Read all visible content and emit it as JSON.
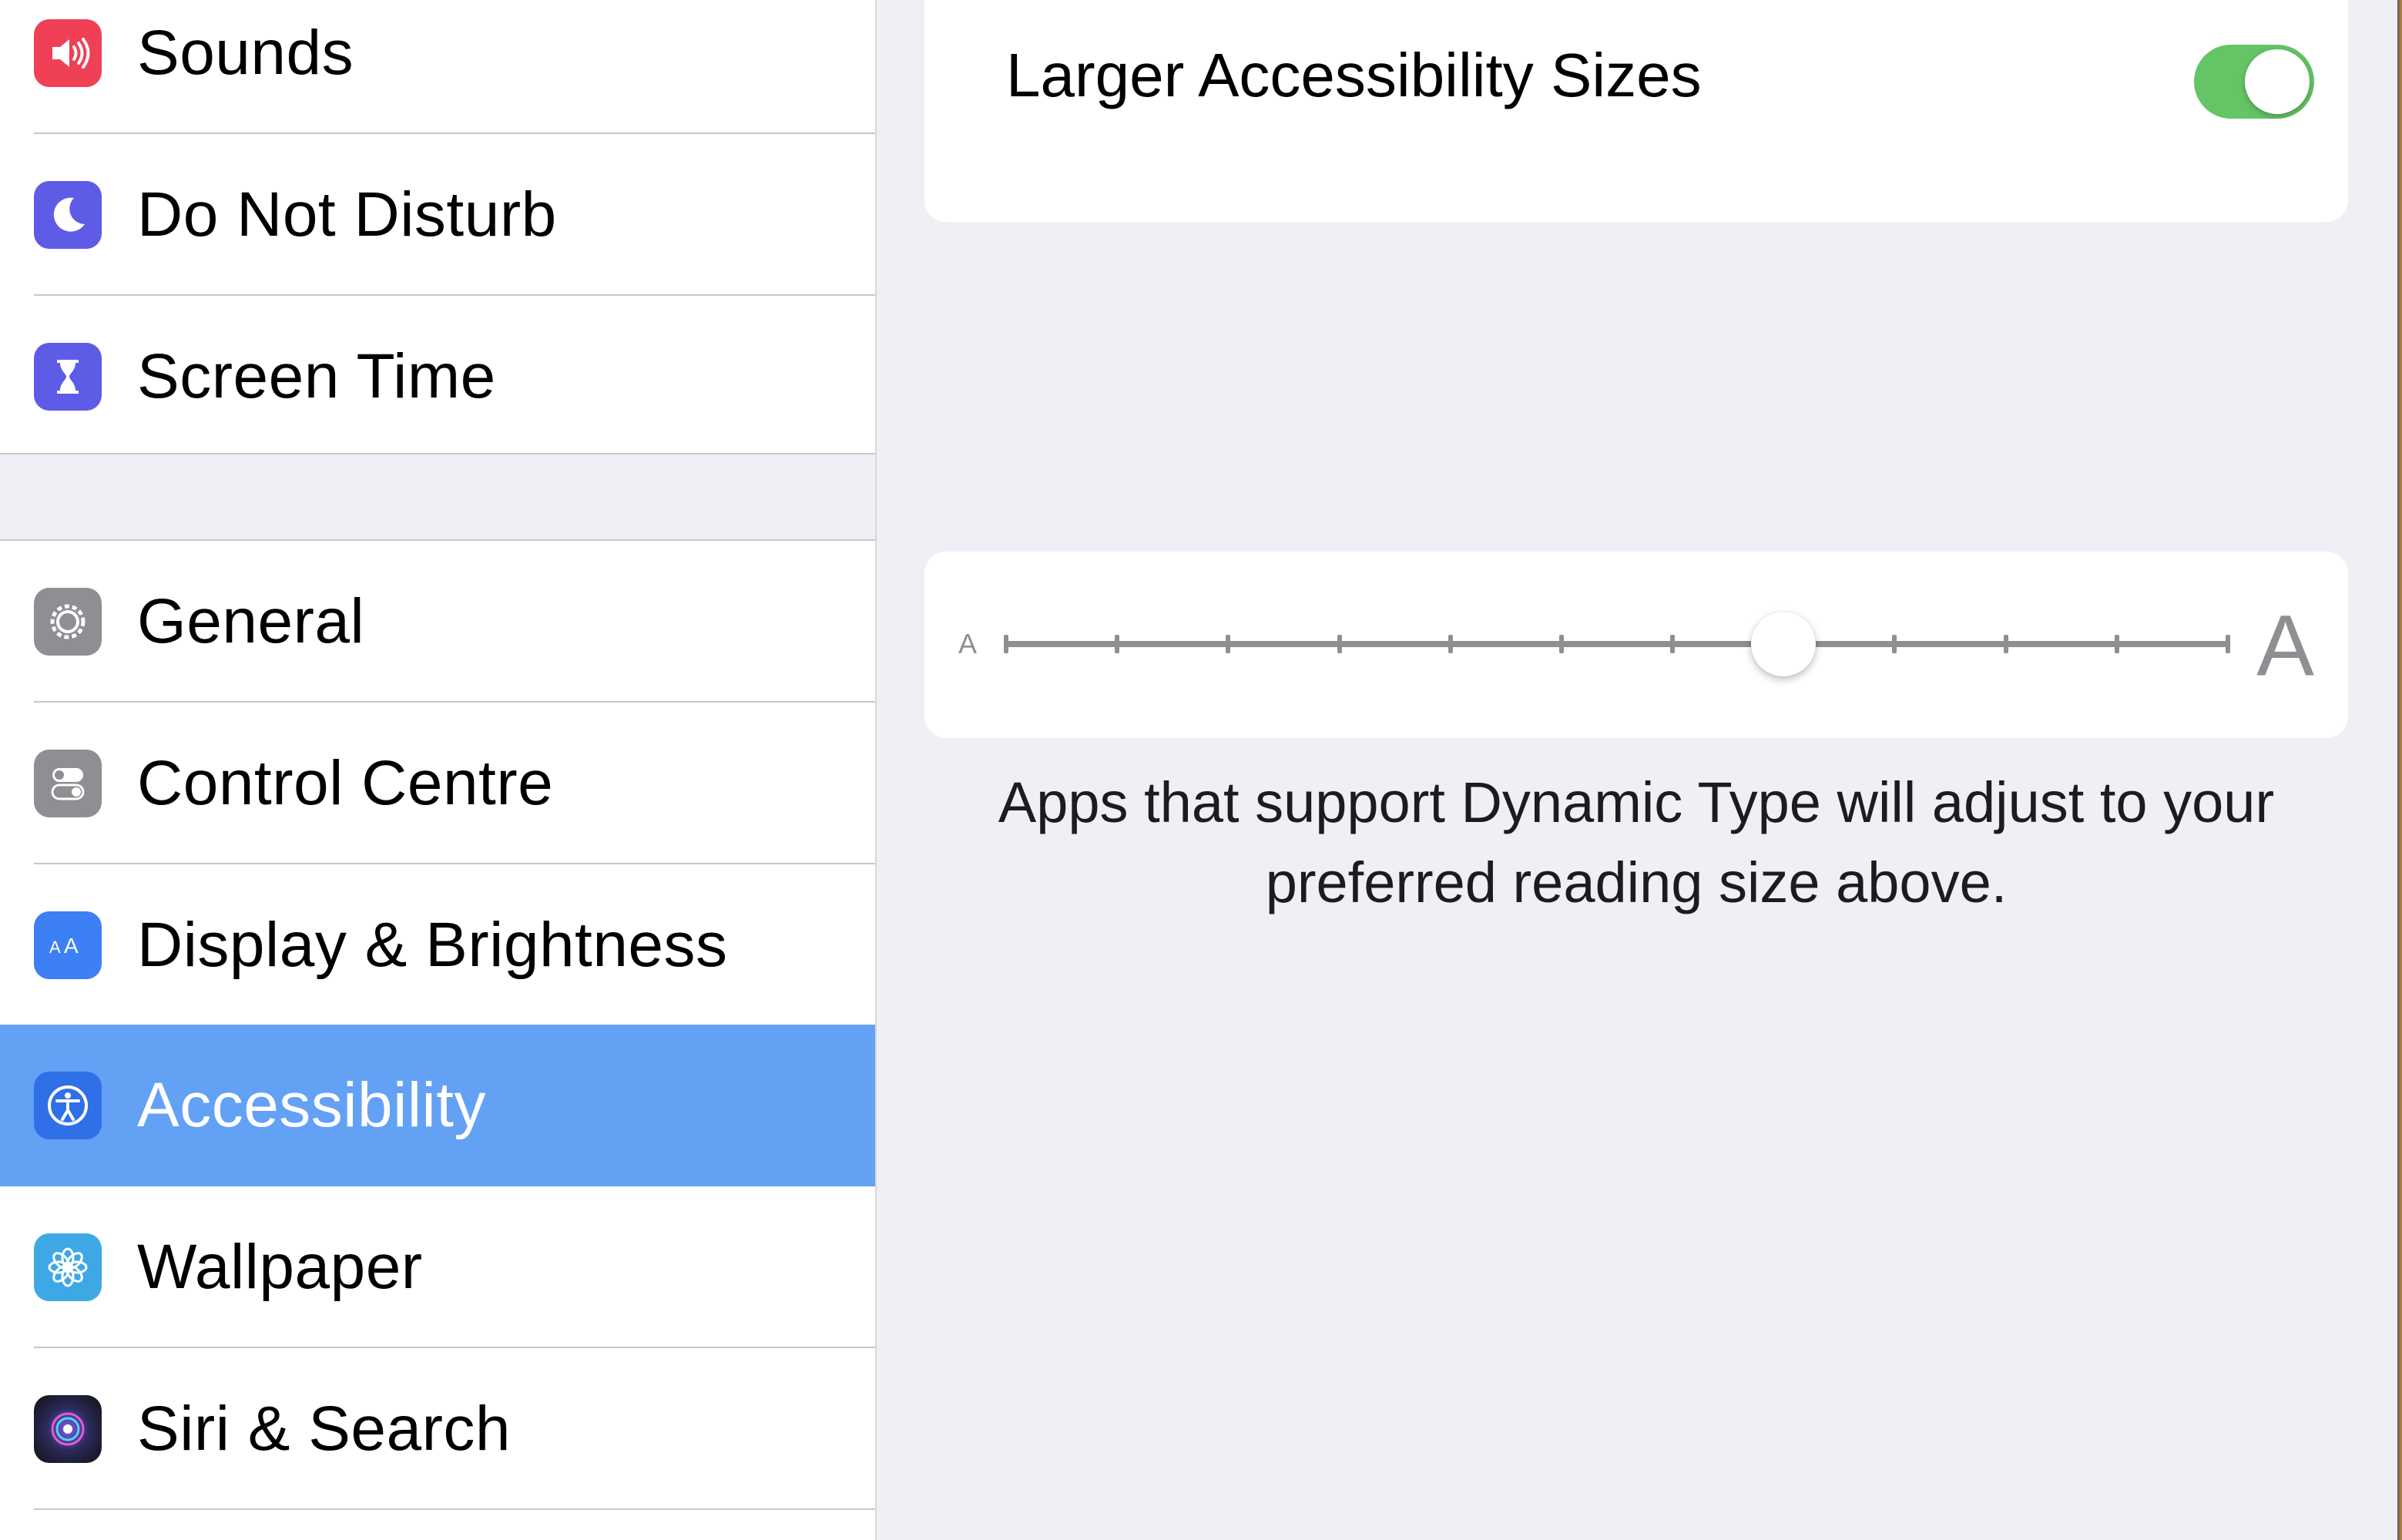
{
  "sidebar": {
    "group1": [
      {
        "label": "Sounds",
        "icon": "speaker-icon",
        "color": "#ef4056"
      },
      {
        "label": "Do Not Disturb",
        "icon": "moon-icon",
        "color": "#5e5ce6"
      },
      {
        "label": "Screen Time",
        "icon": "hourglass-icon",
        "color": "#5e5ce6"
      }
    ],
    "group2": [
      {
        "label": "General",
        "icon": "gear-icon",
        "color": "#8e8e93"
      },
      {
        "label": "Control Centre",
        "icon": "toggles-icon",
        "color": "#8e8e93"
      },
      {
        "label": "Display & Brightness",
        "icon": "text-size-icon",
        "color": "#3d7ff5"
      },
      {
        "label": "Accessibility",
        "icon": "accessibility-icon",
        "color": "#2f6fe8",
        "selected": true
      },
      {
        "label": "Wallpaper",
        "icon": "flower-icon",
        "color": "#3ea8e5"
      },
      {
        "label": "Siri & Search",
        "icon": "siri-icon",
        "color": "#1a1a2e"
      }
    ],
    "selected_color": "#63a1f5"
  },
  "detail": {
    "larger_sizes": {
      "label": "Larger Accessibility Sizes",
      "on": true,
      "color": "#65c466"
    },
    "text_size_slider": {
      "small_label": "A",
      "large_label": "A",
      "steps": 12,
      "selected_step": 8
    },
    "footnote": "Apps that support Dynamic Type will adjust to your preferred reading size above."
  }
}
